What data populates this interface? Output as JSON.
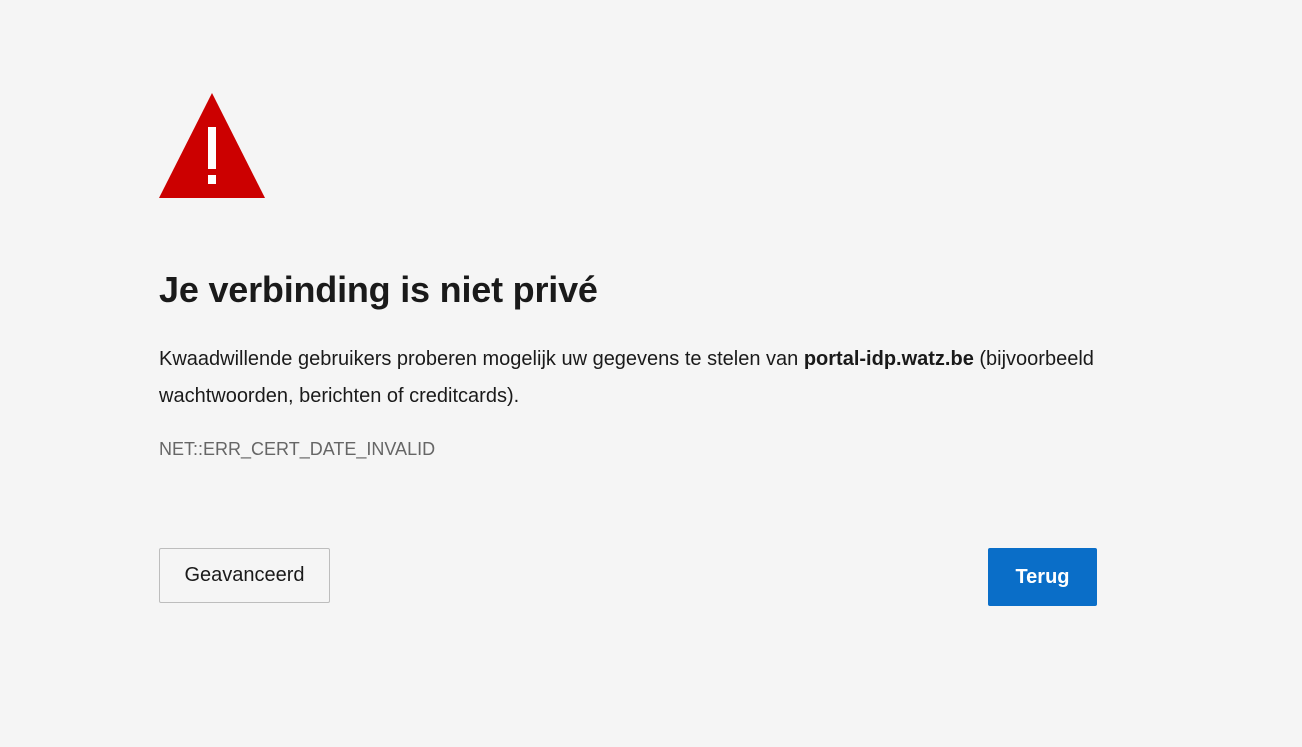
{
  "icon": {
    "name": "warning-triangle-icon",
    "color": "#cc0000"
  },
  "title": "Je verbinding is niet privé",
  "description": {
    "prefix": "Kwaadwillende gebruikers proberen mogelijk uw gegevens te stelen van ",
    "host": "portal-idp.watz.be",
    "suffix": " (bijvoorbeeld wachtwoorden, berichten of creditcards)."
  },
  "error_code": "NET::ERR_CERT_DATE_INVALID",
  "buttons": {
    "advanced_label": "Geavanceerd",
    "back_label": "Terug"
  },
  "colors": {
    "background": "#f5f5f5",
    "primary_button": "#0a6ec8",
    "warning": "#cc0000"
  }
}
